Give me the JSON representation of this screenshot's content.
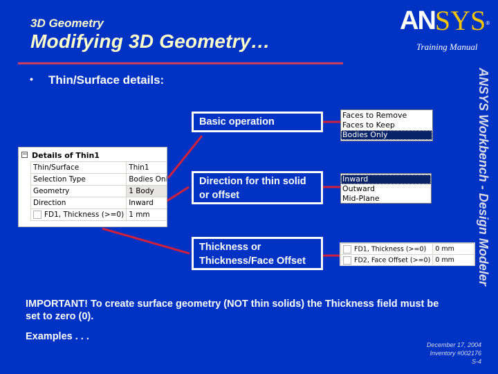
{
  "header": {
    "subtitle": "3D Geometry",
    "title": "Modifying 3D Geometry…",
    "logo": {
      "part1": "AN",
      "part2": "SYS",
      "trademark": "®"
    },
    "training_manual": "Training Manual"
  },
  "side_label": "ANSYS Workbench - Design Modeler",
  "bullet": {
    "symbol": "•",
    "text": "Thin/Surface details:"
  },
  "details_panel": {
    "collapse_symbol": "−",
    "heading": "Details of Thin1",
    "rows": [
      {
        "label": "Thin/Surface",
        "value": "Thin1"
      },
      {
        "label": "Selection Type",
        "value": "Bodies Only"
      },
      {
        "label": "Geometry",
        "value": "1 Body"
      },
      {
        "label": "Direction",
        "value": "Inward"
      },
      {
        "label": "FD1, Thickness (>=0)",
        "value": "1 mm",
        "checkbox": true
      }
    ]
  },
  "callouts": [
    {
      "text": "Basic operation"
    },
    {
      "text": "Direction for thin solid or offset"
    },
    {
      "text": "Thickness or Thickness/Face Offset"
    }
  ],
  "selection_type_list": {
    "options": [
      "Faces to Remove",
      "Faces to Keep",
      "Bodies Only"
    ],
    "selected": "Bodies Only"
  },
  "direction_list": {
    "options": [
      "Inward",
      "Outward",
      "Mid-Plane"
    ],
    "selected": "Inward"
  },
  "thickness_table": {
    "rows": [
      {
        "label": "FD1, Thickness (>=0)",
        "value": "0 mm"
      },
      {
        "label": "FD2, Face Offset (>=0)",
        "value": "0 mm"
      }
    ]
  },
  "important_note": "IMPORTANT! To create surface geometry (NOT thin solids) the Thickness field must be set to zero (0).",
  "examples": "Examples . . .",
  "footer": {
    "date": "December 17, 2004",
    "inventory": "Inventory #002176",
    "page": "S-4"
  },
  "colors": {
    "background": "#0033c4",
    "title": "#ffffcc",
    "accent_red": "#c8405c",
    "logo_yellow": "#f5c400",
    "list_selected": "#0a246a"
  }
}
